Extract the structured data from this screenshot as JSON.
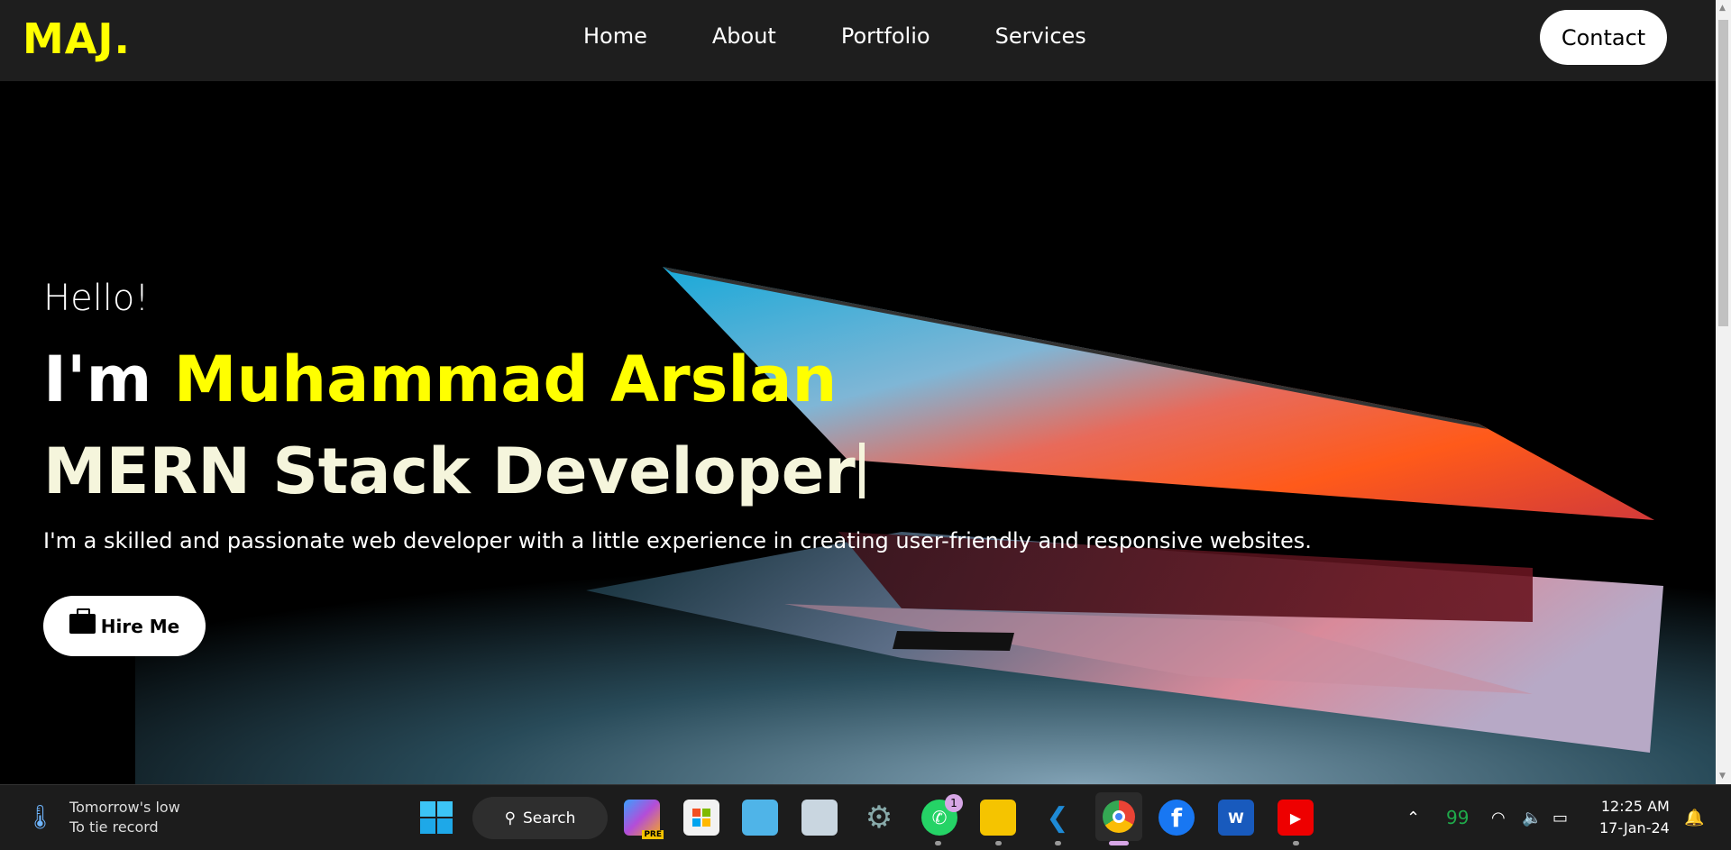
{
  "header": {
    "logo": "MAJ.",
    "nav": [
      "Home",
      "About",
      "Portfolio",
      "Services"
    ],
    "contact": "Contact"
  },
  "hero": {
    "greeting": "Hello!",
    "intro": "I'm ",
    "name": "Muhammad Arslan",
    "role": "MERN Stack Developer",
    "description": "I'm a skilled and passionate web developer with a little experience in creating user-friendly and responsive websites.",
    "hire_button": "Hire Me"
  },
  "taskbar": {
    "weather_line1": "Tomorrow's low",
    "weather_line2": "To tie record",
    "search": "Search",
    "copilot_badge": "PRE",
    "whatsapp_badge": "1",
    "tray_number": "99",
    "time": "12:25 AM",
    "date": "17-Jan-24"
  },
  "colors": {
    "accent": "#ffff00",
    "header_bg": "#1e1e1e",
    "role_text": "#f5f5dc"
  }
}
